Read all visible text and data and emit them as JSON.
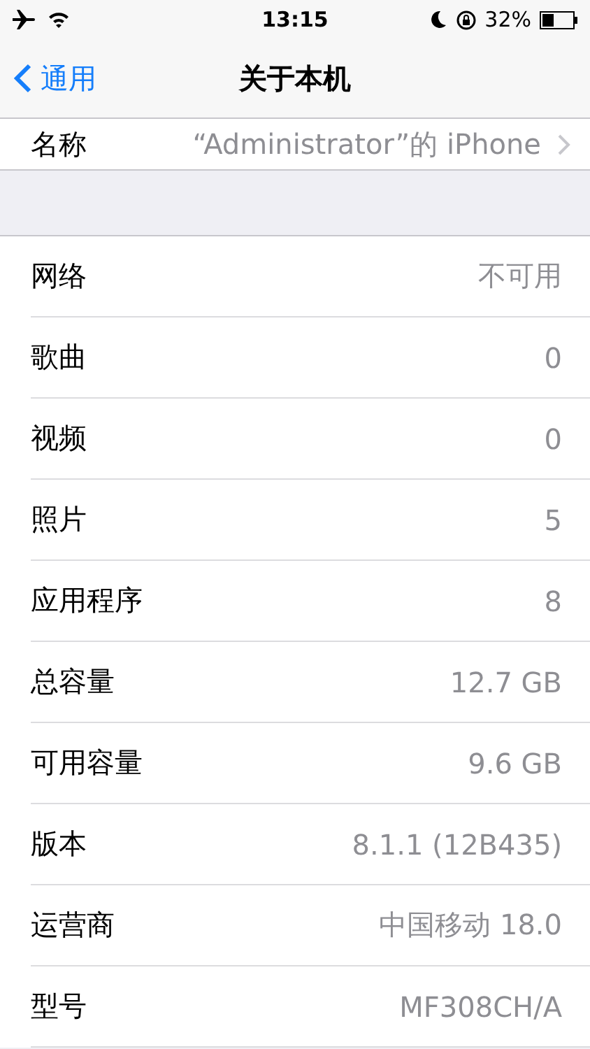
{
  "status_bar": {
    "time": "13:15",
    "battery": "32%"
  },
  "nav": {
    "back": "通用",
    "title": "关于本机"
  },
  "name_row": {
    "label": "名称",
    "value": "“Administrator”的 iPhone"
  },
  "rows": [
    {
      "label": "网络",
      "value": "不可用"
    },
    {
      "label": "歌曲",
      "value": "0"
    },
    {
      "label": "视频",
      "value": "0"
    },
    {
      "label": "照片",
      "value": "5"
    },
    {
      "label": "应用程序",
      "value": "8"
    },
    {
      "label": "总容量",
      "value": "12.7 GB"
    },
    {
      "label": "可用容量",
      "value": "9.6 GB"
    },
    {
      "label": "版本",
      "value": "8.1.1 (12B435)"
    },
    {
      "label": "运营商",
      "value": "中国移动 18.0"
    },
    {
      "label": "型号",
      "value": "MF308CH/A"
    }
  ]
}
